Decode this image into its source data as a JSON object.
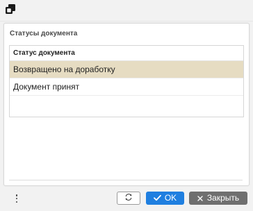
{
  "topbar": {
    "icon": "window-restore-icon"
  },
  "panel": {
    "title": "Статусы документа",
    "table": {
      "header": "Статус документа",
      "rows": [
        {
          "label": "Возвращено на доработку",
          "selected": true
        },
        {
          "label": "Документ принят",
          "selected": false
        }
      ]
    }
  },
  "footer": {
    "more_icon": "more-vertical-icon",
    "refresh_icon": "refresh-icon",
    "ok_icon": "check-icon",
    "ok_label": "OK",
    "close_icon": "close-icon",
    "close_label": "Закрыть"
  },
  "colors": {
    "selected_row": "#e6dcc2",
    "ok_button": "#1f7fe0",
    "close_button": "#6f6f6f"
  }
}
